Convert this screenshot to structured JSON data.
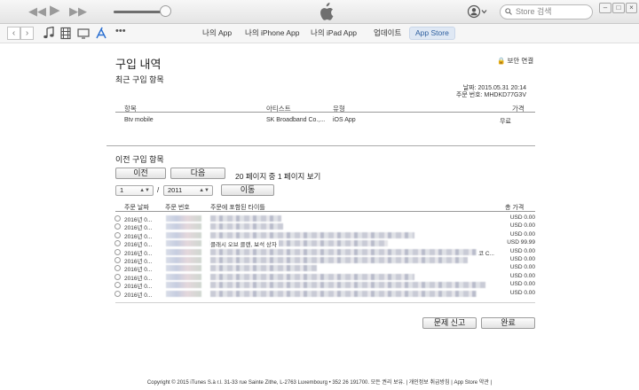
{
  "topbar": {
    "search_placeholder": "Store 검색",
    "window_min": "–",
    "window_max": "□",
    "window_close": "×"
  },
  "nav": {
    "links": [
      "나의 App",
      "나의 iPhone App",
      "나의 iPad App",
      "업데이트",
      "App Store"
    ],
    "active": "App Store"
  },
  "page": {
    "title": "구입 내역",
    "secure_label": "보안 연결",
    "recent_heading": "최근 구입 항목",
    "date_label": "날짜:",
    "date_value": "2015.05.31 20:14",
    "order_label": "주문 번호:",
    "order_value": "MHDKD77G3V",
    "recent_headers": {
      "item": "항목",
      "artist": "아티스트",
      "type": "유형",
      "price": "가격"
    },
    "recent_row": {
      "item": "Btv mobile",
      "artist": "SK Broadband Co.,...",
      "type": "iOS App",
      "price": "무료"
    },
    "previous_heading": "이전 구입 항목",
    "prev_button": "이전",
    "next_button": "다음",
    "page_info": "20 페이지 중 1 페이지 보기",
    "month_value": "1",
    "year_value": "2011",
    "go_button": "이동",
    "list_headers": {
      "order_date": "주문 날짜",
      "order_no": "주문 번호",
      "titles": "주문에 포함된 타이틀",
      "total": "총 가격"
    },
    "rows": [
      {
        "date": "2016년 0...",
        "title": "",
        "price": "USD 0.00"
      },
      {
        "date": "2016년 0...",
        "title": "",
        "price": "USD 0.00"
      },
      {
        "date": "2016년 0...",
        "title": "",
        "price": "USD 0.00"
      },
      {
        "date": "2016년 0...",
        "title": "클래시 오브 클랜, 보석 상자",
        "price": "USD 99.99"
      },
      {
        "date": "2016년 0...",
        "title": "",
        "price": "USD 0.00"
      },
      {
        "date": "2016년 0...",
        "title": "",
        "price": "USD 0.00"
      },
      {
        "date": "2016년 0...",
        "title": "",
        "price": "USD 0.00"
      },
      {
        "date": "2016년 0...",
        "title": "",
        "price": "USD 0.00"
      },
      {
        "date": "2016년 0...",
        "title": "",
        "price": "USD 0.00"
      },
      {
        "date": "2016년 0...",
        "title": "",
        "price": "USD 0.00"
      }
    ],
    "row4_suffix": "코 C...",
    "report_button": "문제 신고",
    "done_button": "완료"
  },
  "footer": {
    "text": "Copyright © 2015 iTunes S.à r.l. 31-33 rue Sainte Zithe, L-2763 Luxembourg • 352 26 191700.  모든 권리 보유. | 개인정보 취급방침 | App Store 약관 |"
  }
}
